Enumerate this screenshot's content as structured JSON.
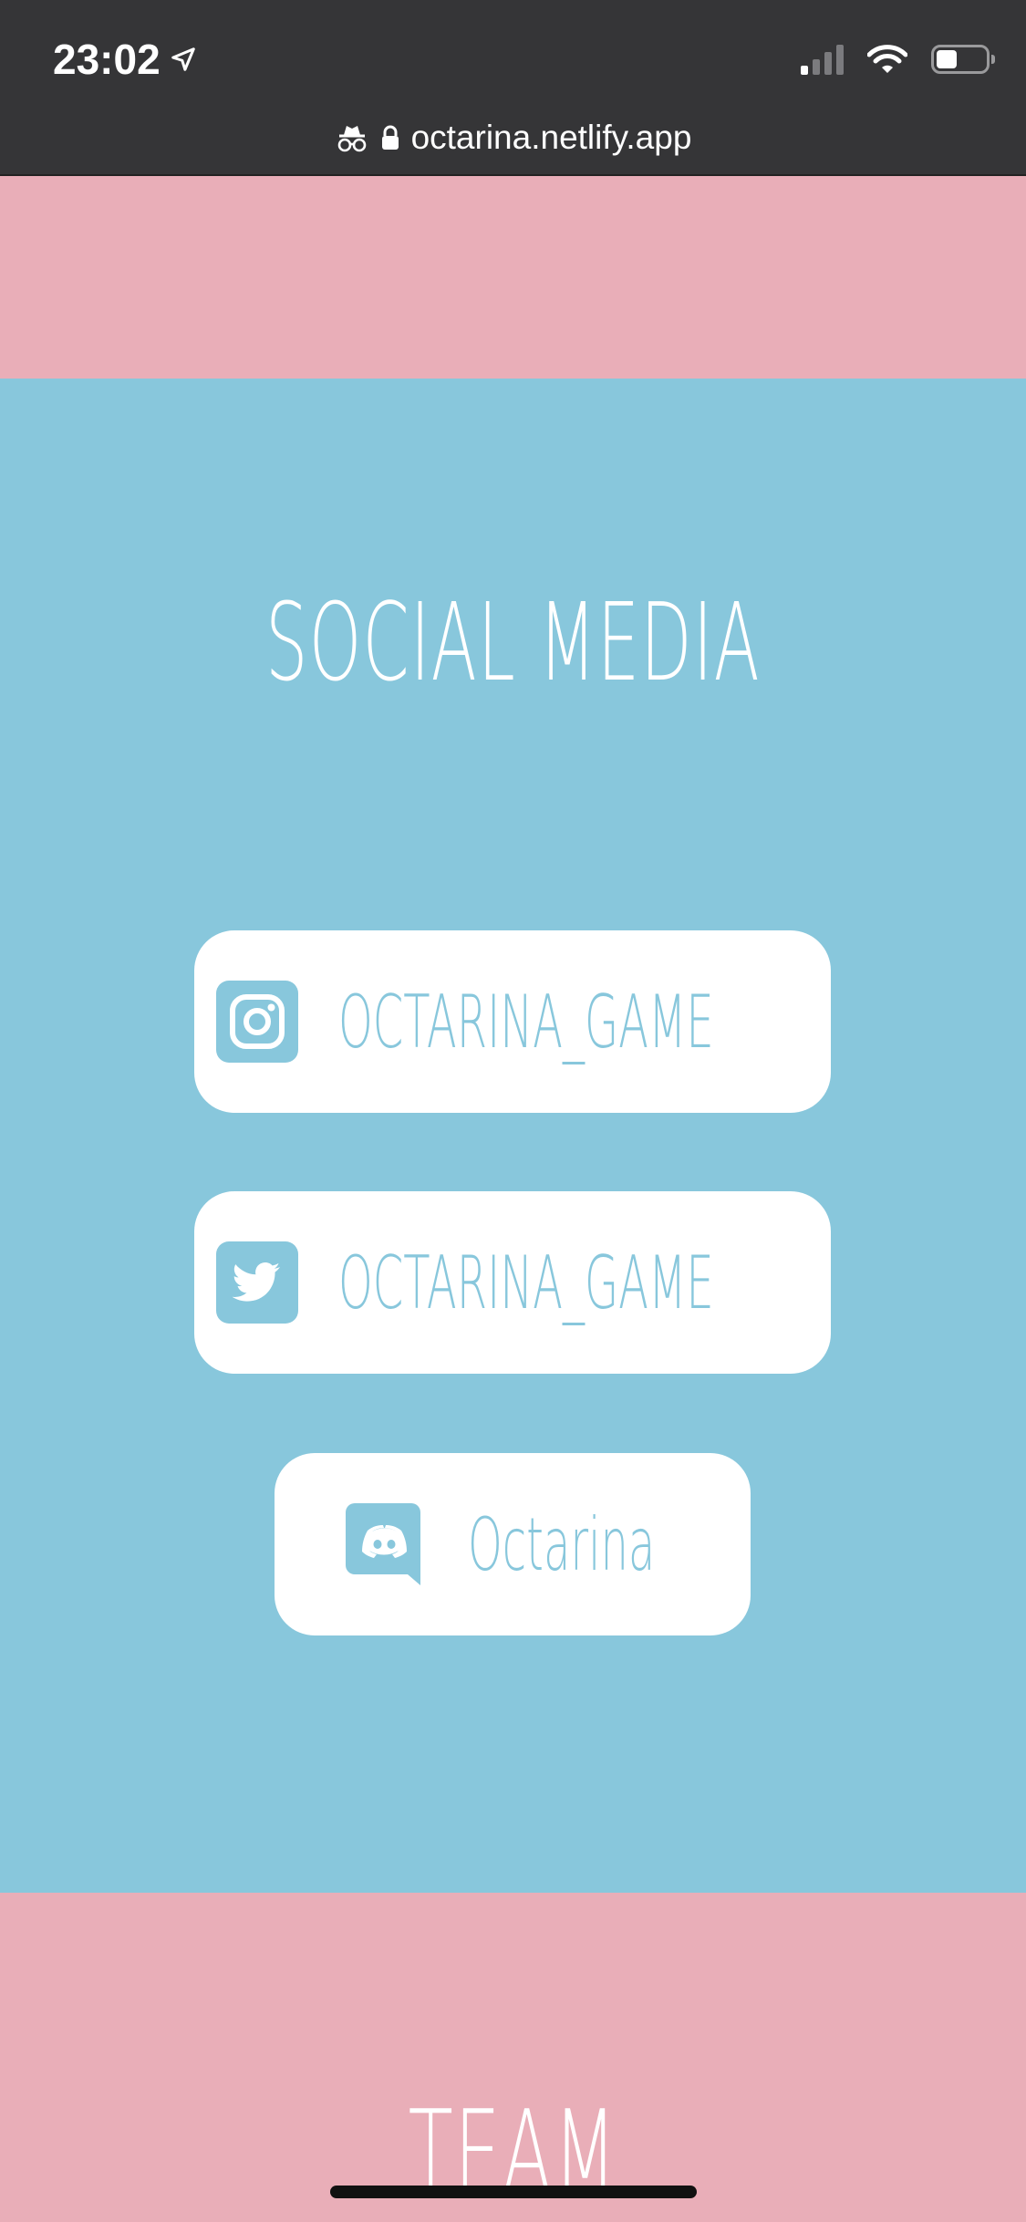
{
  "status_bar": {
    "time": "23:02",
    "icons": [
      "location-arrow-icon",
      "signal-icon",
      "wifi-icon",
      "battery-icon"
    ]
  },
  "browser": {
    "url": "octarina.netlify.app",
    "icons": [
      "incognito-icon",
      "lock-icon"
    ]
  },
  "social": {
    "title": "SOCIAL MEDIA",
    "links": [
      {
        "label": "OCTARINA_GAME",
        "icon": "instagram-icon"
      },
      {
        "label": "OCTARINA_GAME",
        "icon": "twitter-icon"
      },
      {
        "label": "Octarina",
        "icon": "discord-icon"
      }
    ]
  },
  "team": {
    "title": "TEAM"
  },
  "colors": {
    "pink": "#e9aeb8",
    "blue": "#88c7dc",
    "chrome": "#353537",
    "white": "#ffffff"
  }
}
